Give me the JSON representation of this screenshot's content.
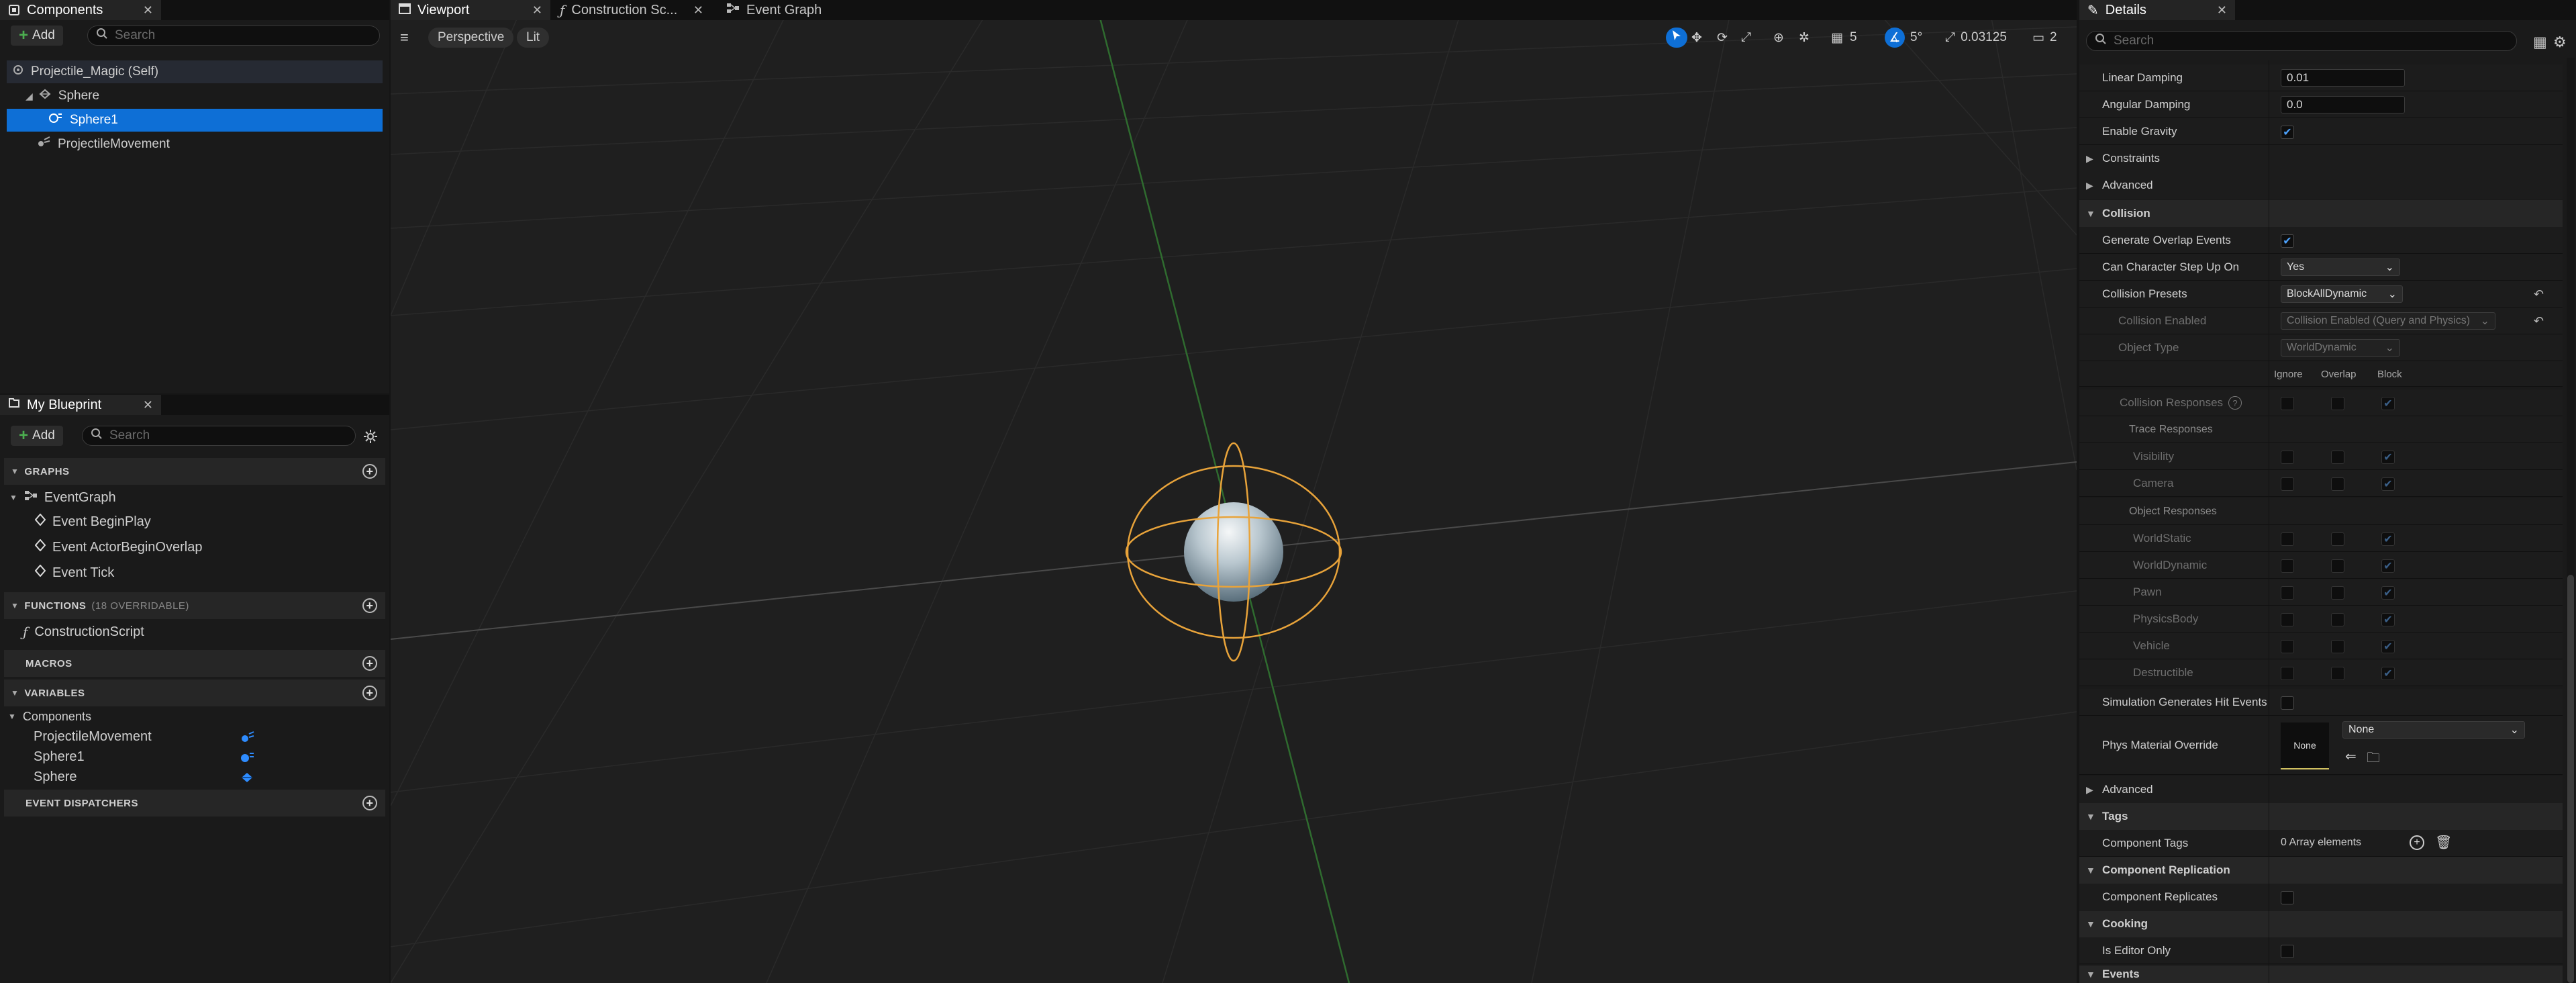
{
  "components_panel": {
    "tab_label": "Components",
    "add_label": "Add",
    "search_placeholder": "Search",
    "tree": [
      {
        "label": "Projectile_Magic (Self)",
        "icon": "blueprint-icon"
      },
      {
        "label": "Sphere",
        "icon": "sphere-mesh-icon"
      },
      {
        "label": "Sphere1",
        "icon": "sphere-collision-icon"
      },
      {
        "label": "ProjectileMovement",
        "icon": "movement-component-icon"
      }
    ]
  },
  "my_blueprint": {
    "tab_label": "My Blueprint",
    "add_label": "Add",
    "search_placeholder": "Search",
    "sections": {
      "graphs": "GRAPHS",
      "functions": "FUNCTIONS",
      "functions_count": "(18 OVERRIDABLE)",
      "macros": "MACROS",
      "variables": "VARIABLES",
      "event_dispatchers": "EVENT DISPATCHERS"
    },
    "graphs": {
      "root": "EventGraph",
      "events": [
        "Event BeginPlay",
        "Event ActorBeginOverlap",
        "Event Tick"
      ]
    },
    "functions": [
      "ConstructionScript"
    ],
    "variables": {
      "category": "Components",
      "items": [
        "ProjectileMovement",
        "Sphere1",
        "Sphere"
      ]
    }
  },
  "editor_tabs": [
    {
      "label": "Viewport"
    },
    {
      "label": "Construction Sc..."
    },
    {
      "label": "Event Graph"
    }
  ],
  "viewport": {
    "view_mode": "Perspective",
    "lighting": "Lit",
    "grid_snap": "5",
    "rotation_snap": "5°",
    "scale_snap": "0.03125",
    "camera_speed": "2"
  },
  "details": {
    "tab_label": "Details",
    "search_placeholder": "Search",
    "linear_damping_label": "Linear Damping",
    "linear_damping_value": "0.01",
    "angular_damping_label": "Angular Damping",
    "angular_damping_value": "0.0",
    "enable_gravity_label": "Enable Gravity",
    "constraints": "Constraints",
    "advanced_1": "Advanced",
    "collision": "Collision",
    "generate_overlap_label": "Generate Overlap Events",
    "step_up_label": "Can Character Step Up On",
    "step_up_value": "Yes",
    "collision_presets_label": "Collision Presets",
    "collision_presets_value": "BlockAllDynamic",
    "collision_enabled_label": "Collision Enabled",
    "collision_enabled_value": "Collision Enabled (Query and Physics)",
    "object_type_label": "Object Type",
    "object_type_value": "WorldDynamic",
    "col_ignore": "Ignore",
    "col_overlap": "Overlap",
    "col_block": "Block",
    "collision_responses_label": "Collision Responses",
    "trace_responses_label": "Trace Responses",
    "trace_channels": [
      "Visibility",
      "Camera"
    ],
    "object_responses_label": "Object Responses",
    "object_channels": [
      "WorldStatic",
      "WorldDynamic",
      "Pawn",
      "PhysicsBody",
      "Vehicle",
      "Destructible"
    ],
    "sim_hit_events_label": "Simulation Generates Hit Events",
    "phys_material_label": "Phys Material Override",
    "phys_material_thumb": "None",
    "phys_material_value": "None",
    "advanced_2": "Advanced",
    "tags": "Tags",
    "component_tags_label": "Component Tags",
    "component_tags_value": "0 Array elements",
    "component_replication": "Component Replication",
    "component_replicates_label": "Component Replicates",
    "cooking": "Cooking",
    "is_editor_only_label": "Is Editor Only",
    "events": "Events"
  },
  "colors": {
    "selection": "#0e6fd6",
    "accent_blue": "#4da3ff",
    "gizmo_orange": "#e8a33a",
    "grid_green": "#2f6b2f"
  }
}
